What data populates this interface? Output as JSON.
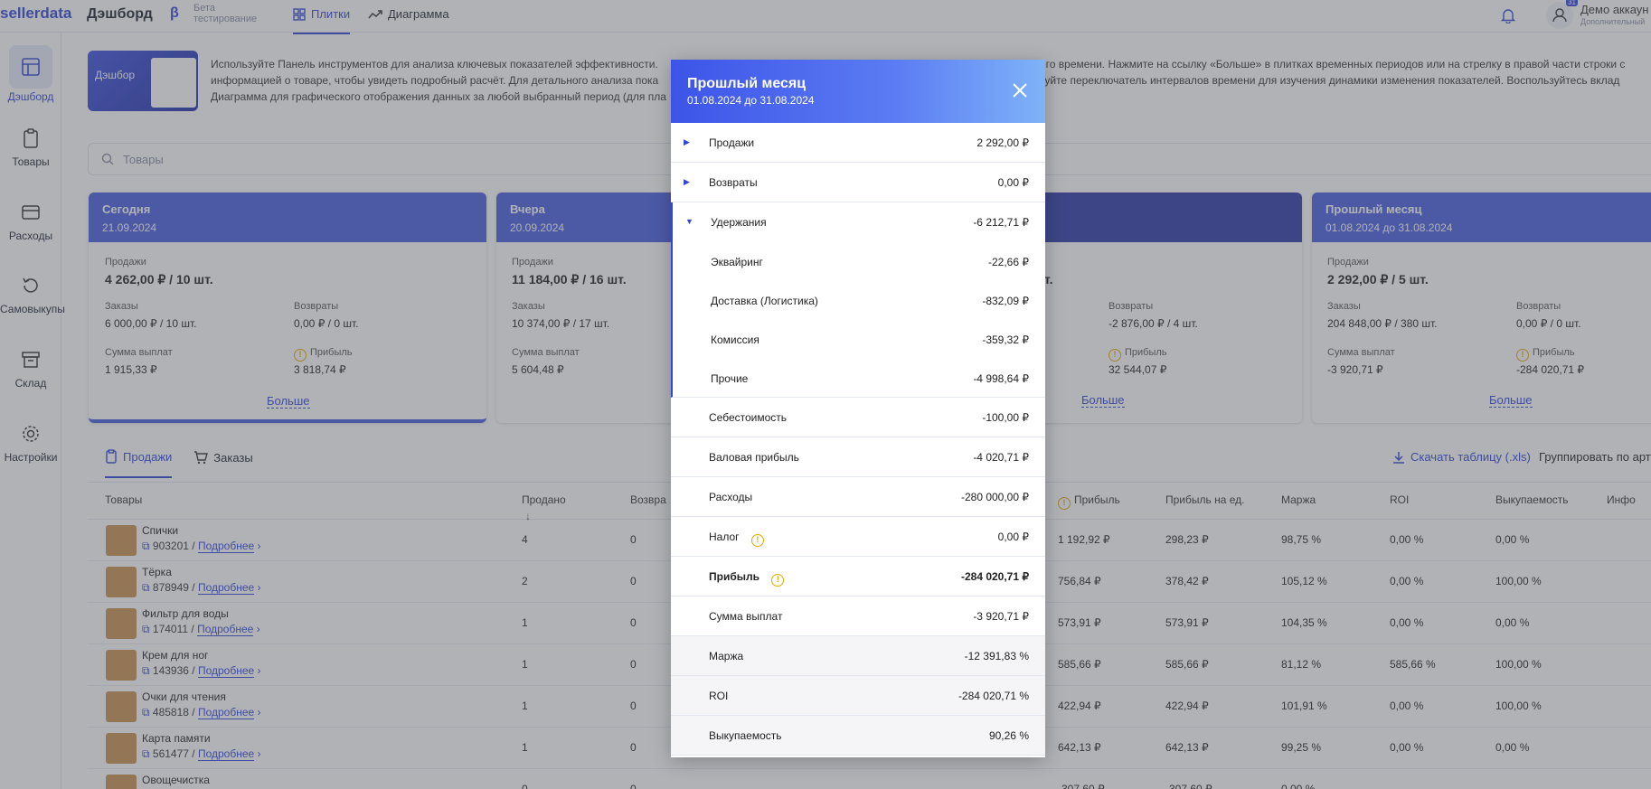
{
  "topbar": {
    "logo": "sellerdata",
    "title": "Дэшборд",
    "beta_mark": "β",
    "beta_label": "Бета тестирование",
    "tabs": [
      {
        "label": "Плитки"
      },
      {
        "label": "Диаграмма"
      }
    ],
    "account_name": "Демо аккаун",
    "account_sub": "Дополнительный",
    "badge": "31"
  },
  "sidebar": {
    "items": [
      {
        "label": "Дэшборд"
      },
      {
        "label": "Товары"
      },
      {
        "label": "Расходы"
      },
      {
        "label": "Самовыкупы"
      },
      {
        "label": "Склад"
      },
      {
        "label": "Настройки"
      }
    ]
  },
  "banner": {
    "image_text": "Дэшбор",
    "line1": "Используйте Панель инструментов для анализа ключевых показателей эффективности.",
    "line1_end": "ого времени. Нажмите на ссылку «Больше» в плитках временных периодов или на стрелку в правой части строки с",
    "line2": "информацией о товаре, чтобы увидеть подробный расчёт. Для детального анализа пока",
    "line2_end": "зуйте переключатель интервалов времени для изучения динамики изменения показателей. Воспользуйтесь вклад",
    "line3": "Диаграмма для графического отображения данных за любой выбранный период (для пла"
  },
  "search": {
    "placeholder": "Товары"
  },
  "cards": [
    {
      "title": "Сегодня",
      "date": "21.09.2024",
      "sales_label": "Продажи",
      "sales": "4 262,00 ₽ / 10 шт.",
      "orders_label": "Заказы",
      "orders": "6 000,00 ₽ / 10 шт.",
      "returns_label": "Возвраты",
      "returns": "0,00 ₽ / 0 шт.",
      "payout_label": "Сумма выплат",
      "payout": "1 915,33 ₽",
      "profit_label": "Прибыль",
      "profit": "3 818,74 ₽",
      "more": "Больше"
    },
    {
      "title": "Вчера",
      "date": "20.09.2024",
      "sales_label": "Продажи",
      "sales": "11 184,00 ₽ / 16 шт.",
      "orders_label": "Заказы",
      "orders": "10 374,00 ₽ / 17 шт.",
      "payout_label": "Сумма выплат",
      "payout": "5 604,48 ₽"
    },
    {
      "sales_tail": "т.",
      "returns_label": "Возвраты",
      "returns": "-2 876,00 ₽ / 4 шт.",
      "profit_label": "Прибыль",
      "profit": "32 544,07 ₽",
      "more": "Больше"
    },
    {
      "title": "Прошлый месяц",
      "date": "01.08.2024 до 31.08.2024",
      "sales_label": "Продажи",
      "sales": "2 292,00 ₽ / 5 шт.",
      "orders_label": "Заказы",
      "orders": "204 848,00 ₽ / 380 шт.",
      "returns_label": "Возвраты",
      "returns": "0,00 ₽ / 0 шт.",
      "payout_label": "Сумма выплат",
      "payout": "-3 920,71 ₽",
      "profit_label": "Прибыль",
      "profit": "-284 020,71 ₽",
      "more": "Больше"
    }
  ],
  "section_tabs": [
    {
      "label": "Продажи"
    },
    {
      "label": "Заказы"
    }
  ],
  "download_label": "Скачать таблицу (.xls)",
  "group_label": "Группировать по арт",
  "table": {
    "headers": [
      "Товары",
      "Продано",
      "Возвра",
      "Прибыль",
      "Прибыль на ед.",
      "Маржа",
      "ROI",
      "Выкупаемость",
      "Инфо"
    ],
    "sort_arrow": "↓",
    "more_link": "Подробнее",
    "rows": [
      {
        "name": "Спички",
        "id": "903201",
        "sold": "4",
        "ret": "0",
        "profit": "1 192,92 ₽",
        "per": "298,23 ₽",
        "margin": "98,75 %",
        "roi": "0,00 %",
        "buyout": "0,00 %"
      },
      {
        "name": "Тёрка",
        "id": "878949",
        "sold": "2",
        "ret": "0",
        "profit": "756,84 ₽",
        "per": "378,42 ₽",
        "margin": "105,12 %",
        "roi": "0,00 %",
        "buyout": "100,00 %"
      },
      {
        "name": "Фильтр для воды",
        "id": "174011",
        "sold": "1",
        "ret": "0",
        "profit": "573,91 ₽",
        "per": "573,91 ₽",
        "margin": "104,35 %",
        "roi": "0,00 %",
        "buyout": "0,00 %"
      },
      {
        "name": "Крем для ног",
        "id": "143936",
        "sold": "1",
        "ret": "0",
        "profit": "585,66 ₽",
        "per": "585,66 ₽",
        "margin": "81,12 %",
        "roi": "585,66 %",
        "buyout": "100,00 %"
      },
      {
        "name": "Очки для чтения",
        "id": "485818",
        "sold": "1",
        "ret": "0",
        "profit": "422,94 ₽",
        "per": "422,94 ₽",
        "margin": "101,91 %",
        "roi": "0,00 %",
        "buyout": "100,00 %"
      },
      {
        "name": "Карта памяти",
        "id": "561477",
        "sold": "1",
        "ret": "0",
        "profit": "642,13 ₽",
        "per": "642,13 ₽",
        "margin": "99,25 %",
        "roi": "0,00 %",
        "buyout": "0,00 %"
      },
      {
        "name": "Овощечистка",
        "id": "",
        "sold": "0",
        "ret": "0",
        "profit": "-307,60 ₽",
        "per": "-307,60 ₽",
        "margin": "0,00 %",
        "roi": "",
        "buyout": ""
      }
    ]
  },
  "modal": {
    "title": "Прошлый месяц",
    "date": "01.08.2024 до 31.08.2024",
    "rows": [
      {
        "label": "Продажи",
        "value": "2 292,00 ₽"
      },
      {
        "label": "Возвраты",
        "value": "0,00 ₽"
      },
      {
        "label": "Удержания",
        "value": "-6 212,71 ₽"
      },
      {
        "label": "Эквайринг",
        "value": "-22,66 ₽"
      },
      {
        "label": "Доставка (Логистика)",
        "value": "-832,09 ₽"
      },
      {
        "label": "Комиссия",
        "value": "-359,32 ₽"
      },
      {
        "label": "Прочие",
        "value": "-4 998,64 ₽"
      },
      {
        "label": "Себестоимость",
        "value": "-100,00 ₽"
      },
      {
        "label": "Валовая прибыль",
        "value": "-4 020,71 ₽"
      },
      {
        "label": "Расходы",
        "value": "-280 000,00 ₽"
      },
      {
        "label": "Налог",
        "value": "0,00 ₽"
      },
      {
        "label": "Прибыль",
        "value": "-284 020,71 ₽"
      },
      {
        "label": "Сумма выплат",
        "value": "-3 920,71 ₽"
      },
      {
        "label": "Маржа",
        "value": "-12 391,83 %"
      },
      {
        "label": "ROI",
        "value": "-284 020,71 %"
      },
      {
        "label": "Выкупаемость",
        "value": "90,26 %"
      }
    ]
  },
  "colors": {
    "accent": "#3347d6",
    "card_head": "#4a5ee0",
    "card_head_dark": "#2f3aa8",
    "warn": "#e0a800"
  }
}
